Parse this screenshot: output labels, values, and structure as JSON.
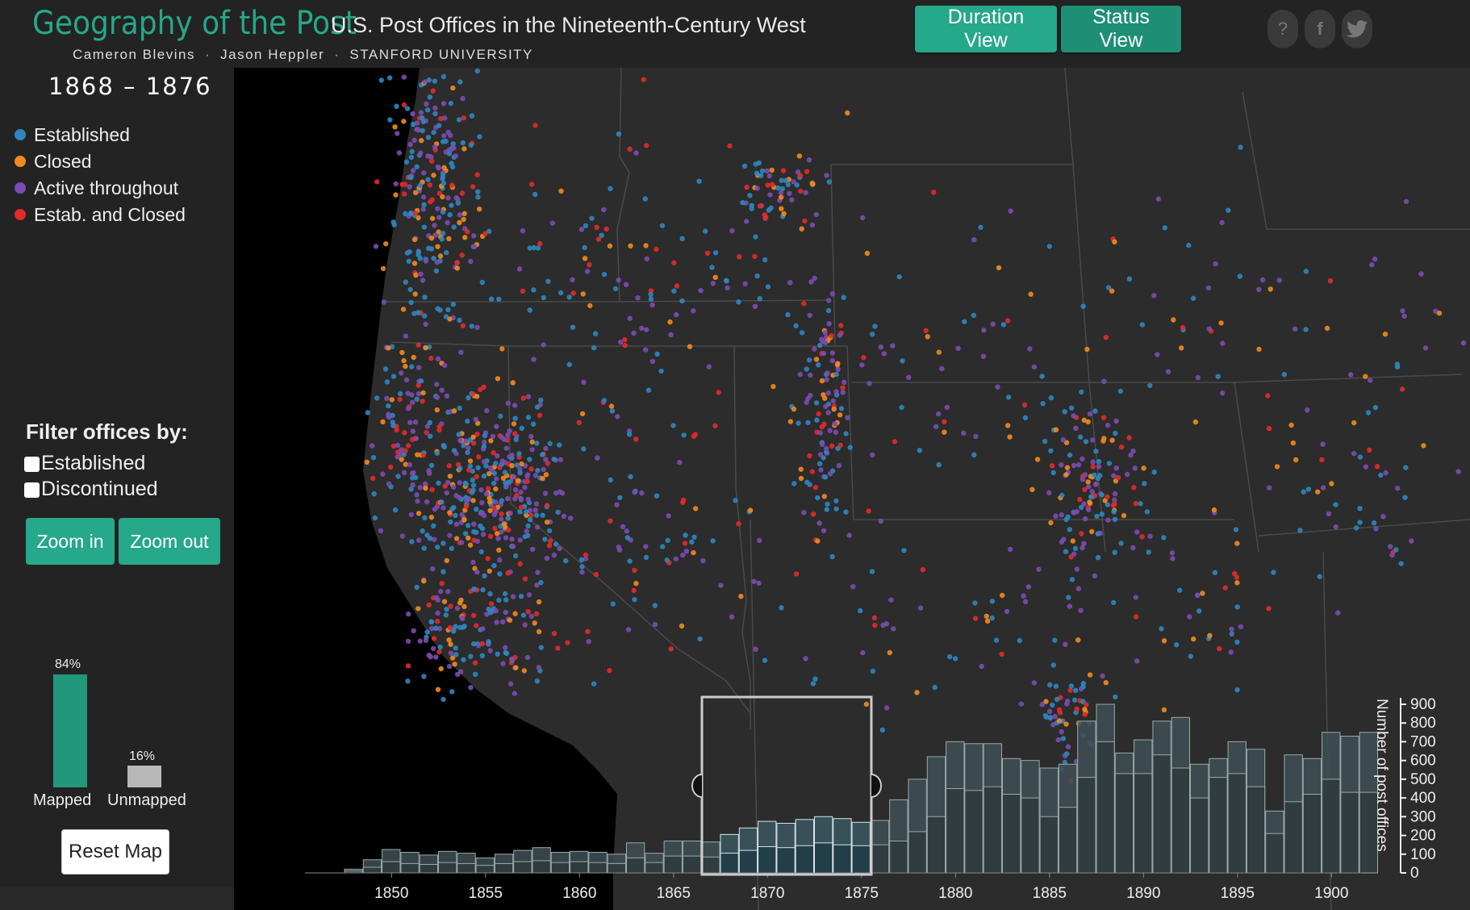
{
  "header": {
    "title": "Geography of the Post",
    "subtitle": "U.S. Post Offices in the Nineteenth-Century West",
    "credits": [
      "Cameron Blevins",
      "Jason Heppler",
      "STANFORD UNIVERSITY"
    ],
    "credit_separator": "·",
    "view_buttons": {
      "duration": "Duration View",
      "status": "Status View"
    },
    "social": {
      "help": "?",
      "facebook": "f",
      "twitter": "t"
    }
  },
  "sidebar": {
    "year_range": "1868 – 1876",
    "legend": [
      {
        "label": "Established",
        "color": "#2e86c1"
      },
      {
        "label": "Closed",
        "color": "#f28a1e"
      },
      {
        "label": "Active throughout",
        "color": "#7c4bb3"
      },
      {
        "label": "Estab. and Closed",
        "color": "#e32a2a"
      }
    ],
    "filter_heading": "Filter offices by:",
    "filters": [
      {
        "label": "Established",
        "checked": false
      },
      {
        "label": "Discontinued",
        "checked": false
      }
    ],
    "zoom_in": "Zoom in",
    "zoom_out": "Zoom out",
    "mapped_pct": "84%",
    "mapped_value": 84,
    "mapped_label": "Mapped",
    "unmapped_pct": "16%",
    "unmapped_value": 16,
    "unmapped_label": "Unmapped",
    "reset": "Reset Map"
  },
  "colors": {
    "accent": "#26a88a",
    "established": "#2e86c1",
    "closed": "#f28a1e",
    "active": "#7c4bb3",
    "estab_closed": "#e32a2a"
  },
  "chart_data": {
    "type": "bar",
    "ylabel": "Number of post offices",
    "yticks": [
      0,
      100,
      200,
      300,
      400,
      500,
      600,
      700,
      800,
      900
    ],
    "ylim": [
      0,
      900
    ],
    "xticks": [
      1850,
      1855,
      1860,
      1865,
      1870,
      1875,
      1880,
      1885,
      1890,
      1895,
      1900
    ],
    "selected_range": [
      1868,
      1876
    ],
    "years": [
      1848,
      1849,
      1850,
      1851,
      1852,
      1853,
      1854,
      1855,
      1856,
      1857,
      1858,
      1859,
      1860,
      1861,
      1862,
      1863,
      1864,
      1865,
      1866,
      1867,
      1868,
      1869,
      1870,
      1871,
      1872,
      1873,
      1874,
      1875,
      1876,
      1877,
      1878,
      1879,
      1880,
      1881,
      1882,
      1883,
      1884,
      1885,
      1886,
      1887,
      1888,
      1889,
      1890,
      1891,
      1892,
      1893,
      1894,
      1895,
      1896,
      1897,
      1898,
      1899,
      1900,
      1901,
      1902
    ],
    "series": [
      {
        "name": "Established",
        "values": [
          20,
          70,
          125,
          110,
          95,
          115,
          105,
          80,
          100,
          120,
          135,
          110,
          115,
          110,
          100,
          160,
          105,
          170,
          170,
          165,
          205,
          240,
          275,
          265,
          285,
          300,
          290,
          270,
          280,
          390,
          500,
          620,
          700,
          690,
          690,
          610,
          600,
          560,
          580,
          810,
          900,
          640,
          710,
          810,
          830,
          580,
          610,
          700,
          660,
          330,
          630,
          610,
          750,
          730,
          750
        ]
      },
      {
        "name": "Closed",
        "values": [
          10,
          30,
          60,
          50,
          45,
          55,
          50,
          40,
          50,
          60,
          65,
          55,
          60,
          55,
          50,
          80,
          55,
          90,
          90,
          85,
          105,
          120,
          140,
          135,
          145,
          160,
          150,
          145,
          150,
          170,
          220,
          300,
          450,
          440,
          460,
          420,
          400,
          300,
          350,
          510,
          700,
          530,
          530,
          630,
          560,
          400,
          510,
          530,
          460,
          210,
          380,
          420,
          500,
          430,
          430
        ]
      }
    ]
  }
}
